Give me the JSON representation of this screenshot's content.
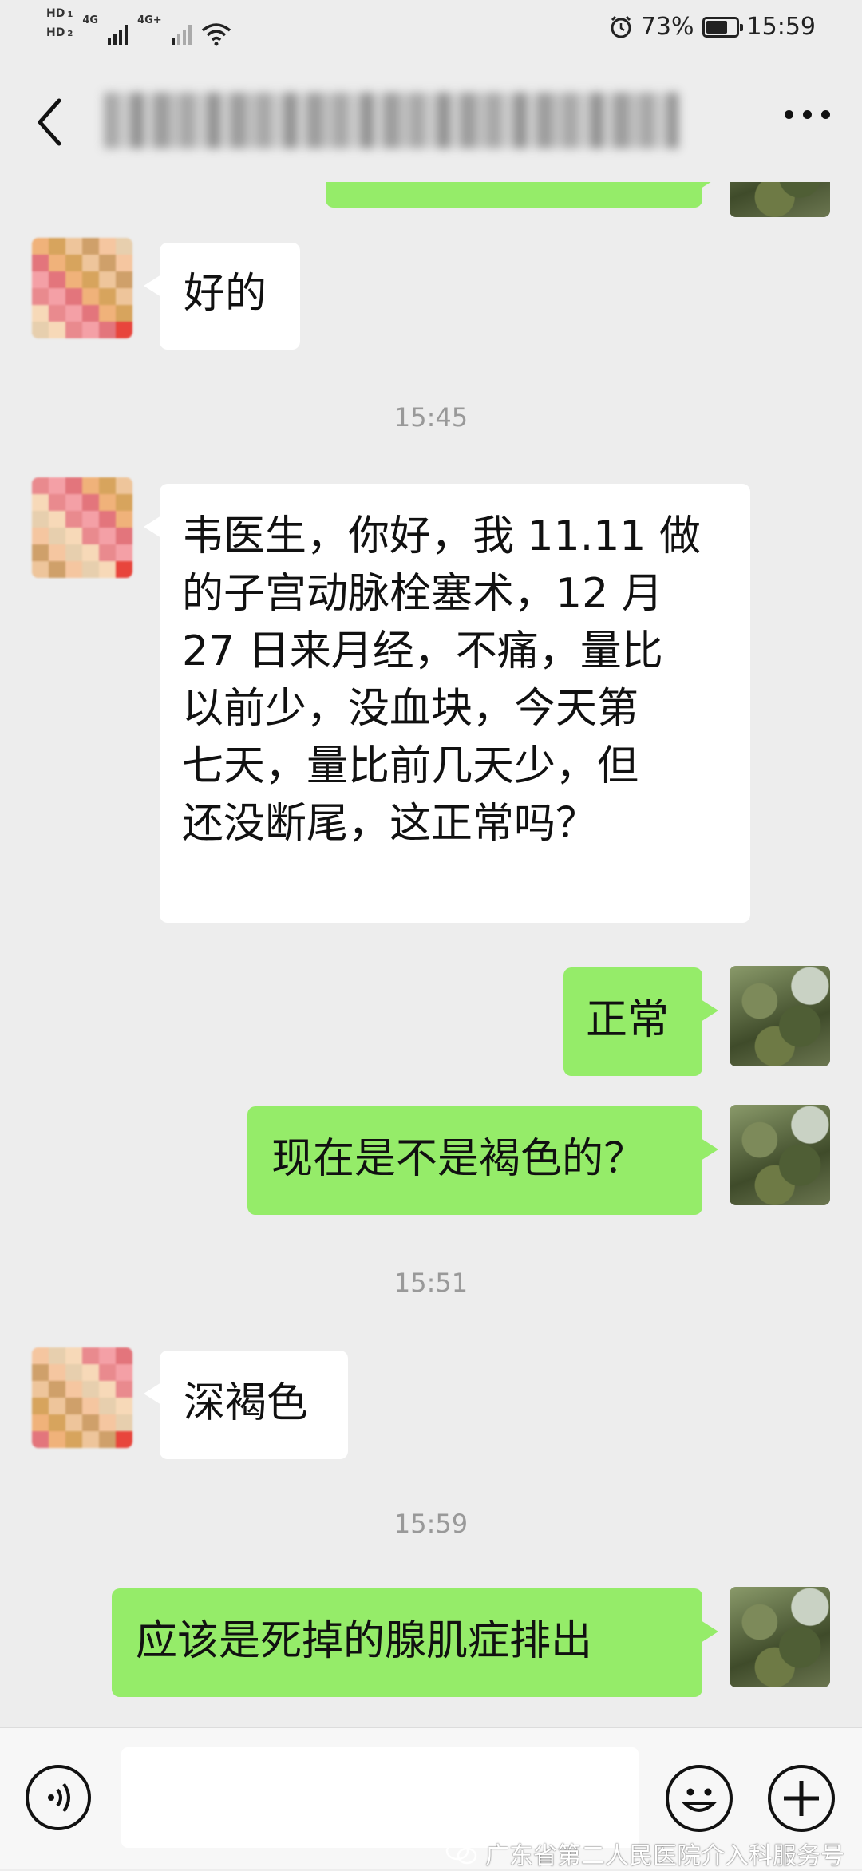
{
  "status_bar": {
    "hd1": "HD",
    "hd1_sub": "1",
    "hd2": "HD",
    "hd2_sub": "2",
    "net1": "4G",
    "net2": "4G+",
    "battery_percent_label": "73%",
    "battery_level": 0.73,
    "time": "15:59"
  },
  "header": {
    "contact_name": ""
  },
  "chat": {
    "messages": [
      {
        "side": "right",
        "text": ""
      },
      {
        "side": "left",
        "text": "好的"
      },
      {
        "type": "time",
        "text": "15:45"
      },
      {
        "side": "left",
        "lines": [
          "韦医生，你好，我 11.11 做",
          "的子宫动脉栓塞术，12 月",
          "27 日来月经，不痛，量比",
          "以前少，没血块，今天第",
          "七天，量比前几天少，但",
          "还没断尾，这正常吗？"
        ]
      },
      {
        "side": "right",
        "text": "正常"
      },
      {
        "side": "right",
        "text": "现在是不是褐色的？"
      },
      {
        "type": "time",
        "text": "15:51"
      },
      {
        "side": "left",
        "text": "深褐色"
      },
      {
        "type": "time",
        "text": "15:59"
      },
      {
        "side": "right",
        "text": "应该是死掉的腺肌症排出"
      }
    ]
  },
  "input_bar": {
    "placeholder": ""
  },
  "watermark": {
    "text": "广东省第二人民医院介入科服务号"
  },
  "colors": {
    "background": "#ededed",
    "bubble_self": "#95ec69",
    "bubble_other": "#ffffff",
    "timestamp": "#999999"
  },
  "icons": {
    "back": "chevron-left-icon",
    "more": "more-dots-icon",
    "voice": "voice-icon",
    "emoji": "emoji-icon",
    "plus": "plus-icon"
  }
}
